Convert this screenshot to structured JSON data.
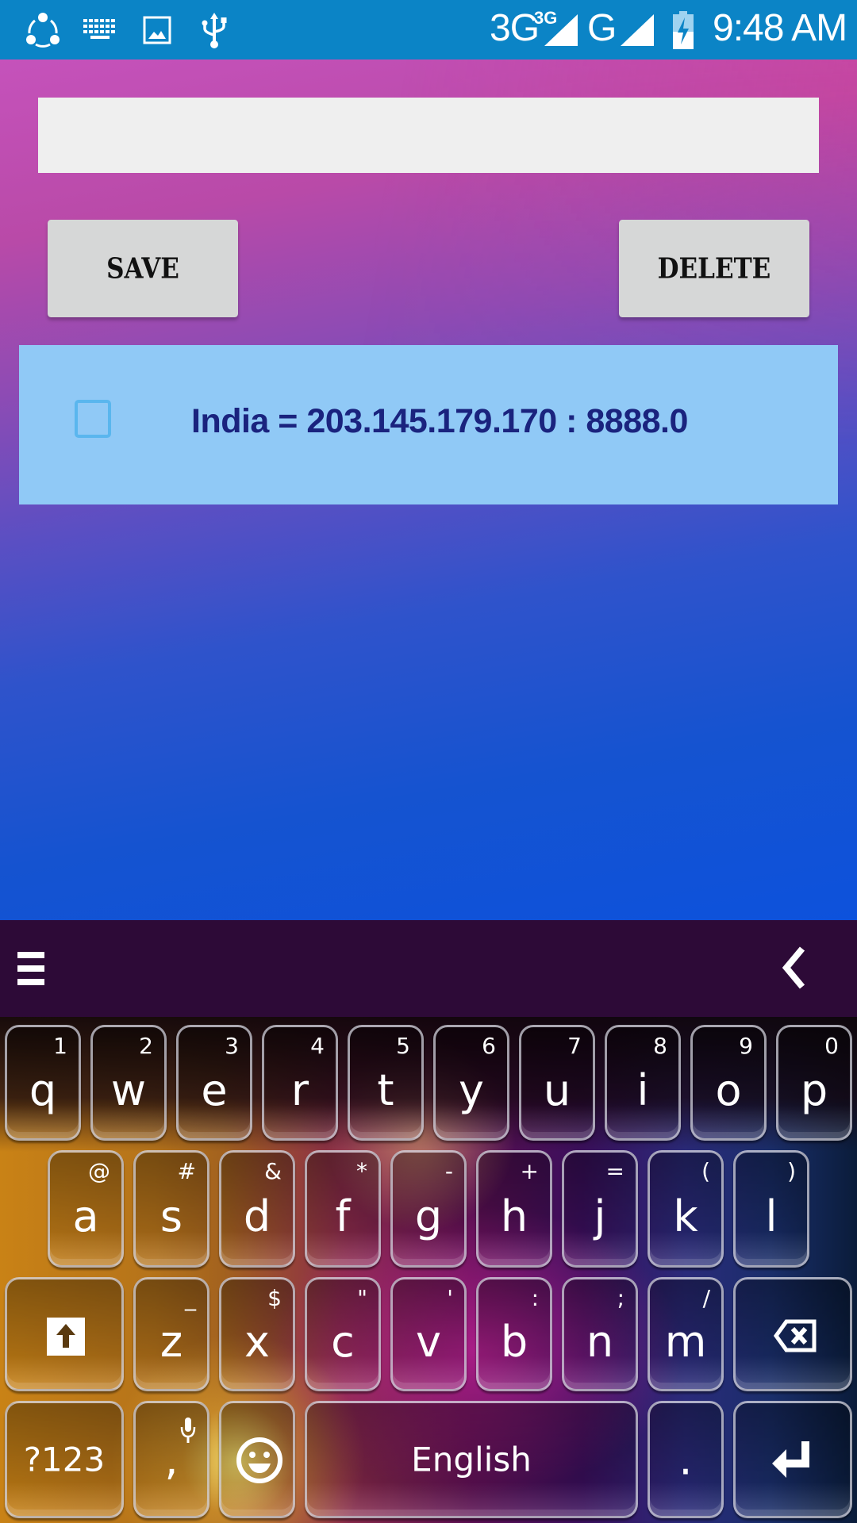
{
  "status_bar": {
    "left_icons": [
      "shareit-icon",
      "keyboard-icon",
      "image-icon",
      "usb-icon"
    ],
    "network_1": "3G",
    "network_1_sup": "3G",
    "network_2": "G",
    "battery_state": "charging",
    "time": "9:48 AM"
  },
  "form": {
    "input_value": "",
    "input_placeholder": "",
    "save_label": "SAVE",
    "delete_label": "DELETE"
  },
  "list": {
    "items": [
      {
        "checked": false,
        "text": "India = 203.145.179.170 : 8888.0"
      }
    ]
  },
  "keyboard": {
    "toolbar": {
      "menu_icon": "menu-icon",
      "collapse_icon": "chevron-left-icon"
    },
    "row1": [
      {
        "key": "q",
        "hint": "1"
      },
      {
        "key": "w",
        "hint": "2"
      },
      {
        "key": "e",
        "hint": "3"
      },
      {
        "key": "r",
        "hint": "4"
      },
      {
        "key": "t",
        "hint": "5"
      },
      {
        "key": "y",
        "hint": "6"
      },
      {
        "key": "u",
        "hint": "7"
      },
      {
        "key": "i",
        "hint": "8"
      },
      {
        "key": "o",
        "hint": "9"
      },
      {
        "key": "p",
        "hint": "0"
      }
    ],
    "row2": [
      {
        "key": "a",
        "hint": "@"
      },
      {
        "key": "s",
        "hint": "#"
      },
      {
        "key": "d",
        "hint": "&"
      },
      {
        "key": "f",
        "hint": "*"
      },
      {
        "key": "g",
        "hint": "-"
      },
      {
        "key": "h",
        "hint": "+"
      },
      {
        "key": "j",
        "hint": "="
      },
      {
        "key": "k",
        "hint": "("
      },
      {
        "key": "l",
        "hint": ")"
      }
    ],
    "row3": [
      {
        "key": "z",
        "hint": "_"
      },
      {
        "key": "x",
        "hint": "$"
      },
      {
        "key": "c",
        "hint": "\""
      },
      {
        "key": "v",
        "hint": "'"
      },
      {
        "key": "b",
        "hint": ":"
      },
      {
        "key": "n",
        "hint": ";"
      },
      {
        "key": "m",
        "hint": "/"
      }
    ],
    "symbols_label": "?123",
    "comma_label": ",",
    "space_label": "English",
    "period_label": "."
  },
  "colors": {
    "status_bar": "#0b84c6",
    "input_bg": "#efefef",
    "button_bg": "#d6d7d7",
    "list_item_bg": "#90c9f6",
    "list_text": "#1a237e",
    "checkbox_border": "#5ab6ee",
    "keyboard_toolbar": "#2d0a37"
  }
}
